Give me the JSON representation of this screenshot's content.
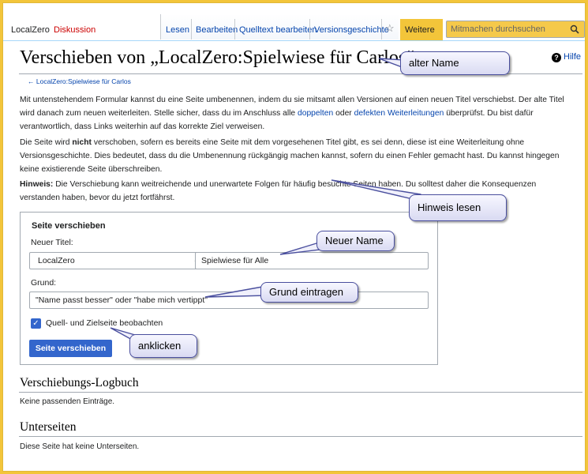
{
  "tabs": {
    "page": "LocalZero",
    "discussion": "Diskussion",
    "read": "Lesen",
    "edit": "Bearbeiten",
    "edit_source": "Quelltext bearbeiten",
    "history": "Versionsgeschichte",
    "more": "Weitere"
  },
  "search": {
    "placeholder": "Mitmachen durchsuchen"
  },
  "help": "Hilfe",
  "title": "Verschieben von „LocalZero:Spielwiese für Carlos“",
  "backlink": "← LocalZero:Spielwiese für Carlos",
  "intro": {
    "t1": "Mit untenstehendem Formular kannst du eine Seite umbenennen, indem du sie mitsamt allen Versionen auf einen neuen Titel verschiebst. Der alte Titel wird danach zum neuen weiterleiten. Stelle sicher, dass du im Anschluss alle ",
    "link1": "doppelten",
    "t2": " oder ",
    "link2": "defekten Weiterleitungen",
    "t3": " überprüfst. Du bist dafür verantwortlich, dass Links weiterhin auf das korrekte Ziel verweisen."
  },
  "notice": {
    "t1": "Die Seite wird ",
    "bold": "nicht",
    "t2": " verschoben, sofern es bereits eine Seite mit dem vorgesehenen Titel gibt, es sei denn, diese ist eine Weiterleitung ohne Versionsgeschichte. Dies bedeutet, dass du die Umbenennung rückgängig machen kannst, sofern du einen Fehler gemacht hast. Du kannst hingegen keine existierende Seite überschreiben."
  },
  "hint": {
    "label": "Hinweis:",
    "text": " Die Verschiebung kann weitreichende und unerwartete Folgen für häufig besuchte Seiten haben. Du solltest daher die Konsequenzen verstanden haben, bevor du jetzt fortfährst."
  },
  "form": {
    "legend": "Seite verschieben",
    "new_title_label": "Neuer Titel:",
    "namespace": "LocalZero",
    "new_title_value": "Spielwiese für Alle",
    "reason_label": "Grund:",
    "reason_value": "\"Name passt besser\" oder \"habe mich vertippt\"",
    "watch_label": "Quell- und Zielseite beobachten",
    "watch_checked": true,
    "submit": "Seite verschieben"
  },
  "log": {
    "heading": "Verschiebungs-Logbuch",
    "text": "Keine passenden Einträge."
  },
  "subpages": {
    "heading": "Unterseiten",
    "text": "Diese Seite hat keine Unterseiten."
  },
  "callouts": {
    "old_name": "alter Name",
    "read_hint": "Hinweis lesen",
    "new_name": "Neuer Name",
    "reason": "Grund eintragen",
    "click": "anklicken"
  },
  "colors": {
    "frame": "#f3c53a",
    "link": "#0645ad",
    "button": "#3366cc",
    "callout_border": "#4a4f9e"
  }
}
